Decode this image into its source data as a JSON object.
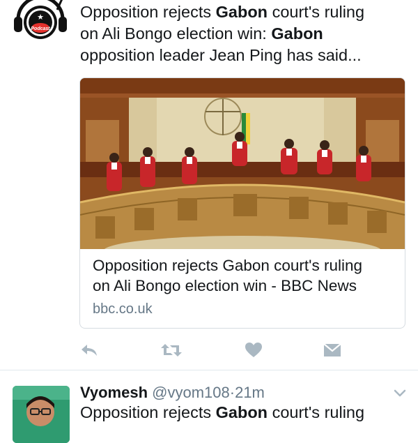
{
  "tweet1": {
    "avatar_label": "Podcast",
    "text_parts": [
      {
        "t": "Opposition rejects ",
        "b": false
      },
      {
        "t": "Gabon",
        "b": true
      },
      {
        "t": " court's ruling",
        "b": false
      },
      {
        "t": "on Ali Bongo election win: ",
        "b": false
      },
      {
        "t": "Gabon",
        "b": true
      },
      {
        "t": "opposition leader Jean Ping has said...",
        "b": false
      }
    ],
    "card": {
      "image": "courtroom-photo",
      "title_line1": "Opposition rejects Gabon court's ruling",
      "title_line2": "on Ali Bongo election win - BBC News",
      "domain": "bbc.co.uk"
    },
    "actions": [
      "reply-icon",
      "retweet-icon",
      "like-icon",
      "direct-message-icon"
    ]
  },
  "tweet2": {
    "name": "Vyomesh",
    "handle": "@vyom108",
    "separator": "·",
    "time": "21m",
    "text_parts": [
      {
        "t": "Opposition rejects ",
        "b": false
      },
      {
        "t": "Gabon",
        "b": true
      },
      {
        "t": " court's ruling",
        "b": false
      }
    ]
  },
  "colors": {
    "text": "#14171a",
    "secondary": "#657786",
    "action_icon": "#aab8c2",
    "border": "#d6dce1"
  }
}
